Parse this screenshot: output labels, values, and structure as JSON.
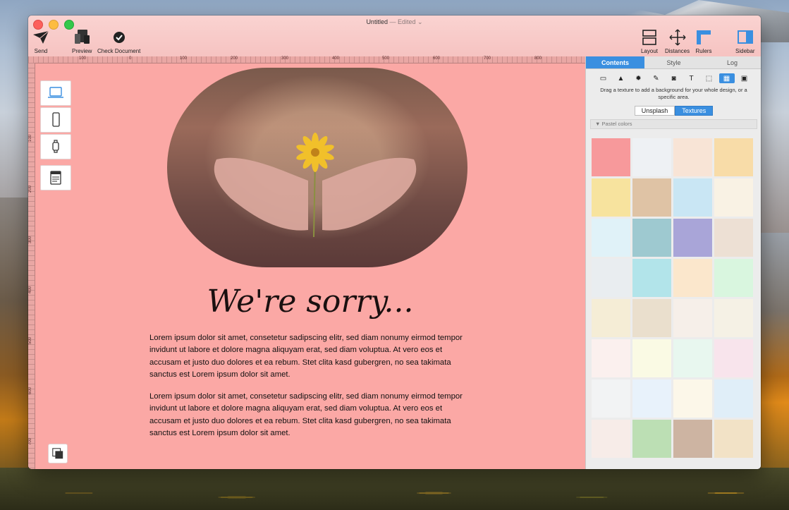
{
  "window": {
    "title": "Untitled",
    "status": "— Edited"
  },
  "toolbar": {
    "send": "Send",
    "preview": "Preview",
    "check_document": "Check Document",
    "layout": "Layout",
    "distances": "Distances",
    "rulers": "Rulers",
    "sidebar": "Sidebar"
  },
  "rulers": {
    "top": [
      "100",
      "0",
      "100",
      "200",
      "300",
      "400",
      "500",
      "600",
      "700",
      "800"
    ],
    "left": [
      "100",
      "200",
      "300",
      "400",
      "500",
      "600",
      "700"
    ]
  },
  "content": {
    "heading": "We're sorry...",
    "paragraph1": "Lorem ipsum dolor sit amet, consetetur sadipscing elitr, sed diam nonumy eirmod tempor invidunt ut labore et dolore magna aliquyam erat, sed diam voluptua. At vero eos et accusam et justo duo dolores et ea rebum. Stet clita kasd gubergren, no sea takimata sanctus est Lorem ipsum dolor sit amet.",
    "paragraph2": "Lorem ipsum dolor sit amet, consetetur sadipscing elitr, sed diam nonumy eirmod tempor invidunt ut labore et dolore magna aliquyam erat, sed diam voluptua. At vero eos et accusam et justo duo dolores et ea rebum. Stet clita kasd gubergren, no sea takimata sanctus est Lorem ipsum dolor sit amet."
  },
  "sidebar": {
    "tabs": [
      "Contents",
      "Style",
      "Log"
    ],
    "hint": "Drag a texture to add a background for your whole design, or a specific area.",
    "segments": [
      "Unsplash",
      "Textures"
    ],
    "group": "Pastel colors",
    "swatches": [
      "#f7999b",
      "#eef1f4",
      "#f8e4d6",
      "#f8dca8",
      "#f7e39e",
      "#dfc3a5",
      "#c9e6f4",
      "#f9f2e4",
      "#e0f2f8",
      "#9ec9d0",
      "#a9a5d8",
      "#ede0d4",
      "#e9edf0",
      "#b2e4ea",
      "#fbe7cc",
      "#d9f6df",
      "#f5edd6",
      "#eadfcd",
      "#f6efe9",
      "#f5f1e5",
      "#fbf0ee",
      "#fafae4",
      "#e8f7ef",
      "#f8e4ec",
      "#f2f3f4",
      "#e8f2fb",
      "#fcf7e9",
      "#e0eef8",
      "#f7ece8",
      "#bcdfb4",
      "#cdb4a2",
      "#f2e2c6"
    ]
  },
  "colors": {
    "accent": "#3a8fe0",
    "canvas_bg": "#fba8a5"
  }
}
